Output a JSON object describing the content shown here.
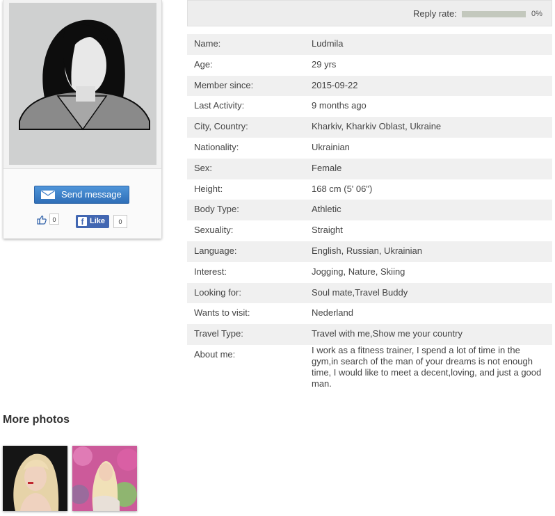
{
  "profile_card": {
    "send_message_label": "Send message",
    "thumbs_count": "0",
    "fb_like_label": "Like",
    "fb_like_count": "0"
  },
  "reply": {
    "label": "Reply rate:",
    "value": "0%",
    "fraction": 0
  },
  "info_rows": [
    {
      "key": "Name:",
      "value": "Ludmila"
    },
    {
      "key": "Age:",
      "value": "29 yrs"
    },
    {
      "key": "Member since:",
      "value": "2015-09-22"
    },
    {
      "key": "Last Activity:",
      "value": "9 months ago"
    },
    {
      "key": "City, Country:",
      "value": "Kharkiv, Kharkiv Oblast, Ukraine"
    },
    {
      "key": "Nationality:",
      "value": "Ukrainian"
    },
    {
      "key": "Sex:",
      "value": "Female"
    },
    {
      "key": "Height:",
      "value": "168 cm (5' 06\")"
    },
    {
      "key": "Body Type:",
      "value": "Athletic"
    },
    {
      "key": "Sexuality:",
      "value": "Straight"
    },
    {
      "key": "Language:",
      "value": "English, Russian, Ukrainian"
    },
    {
      "key": "Interest:",
      "value": "Jogging, Nature, Skiing"
    },
    {
      "key": "Looking for:",
      "value": "Soul mate,Travel Buddy"
    },
    {
      "key": "Wants to visit:",
      "value": "Nederland"
    },
    {
      "key": "Travel Type:",
      "value": "Travel with me,Show me your country"
    },
    {
      "key": "About me:",
      "value": "I work as a fitness trainer, I spend a lot of time in the gym,in search of the man of your dreams is not enough time, I would like to meet a decent,loving, and just a good man."
    }
  ],
  "more_photos": {
    "title": "More photos"
  },
  "colors": {
    "button_blue": "#3a7cc8",
    "facebook_blue": "#4267b2",
    "row_alt": "#f0f0f0"
  }
}
